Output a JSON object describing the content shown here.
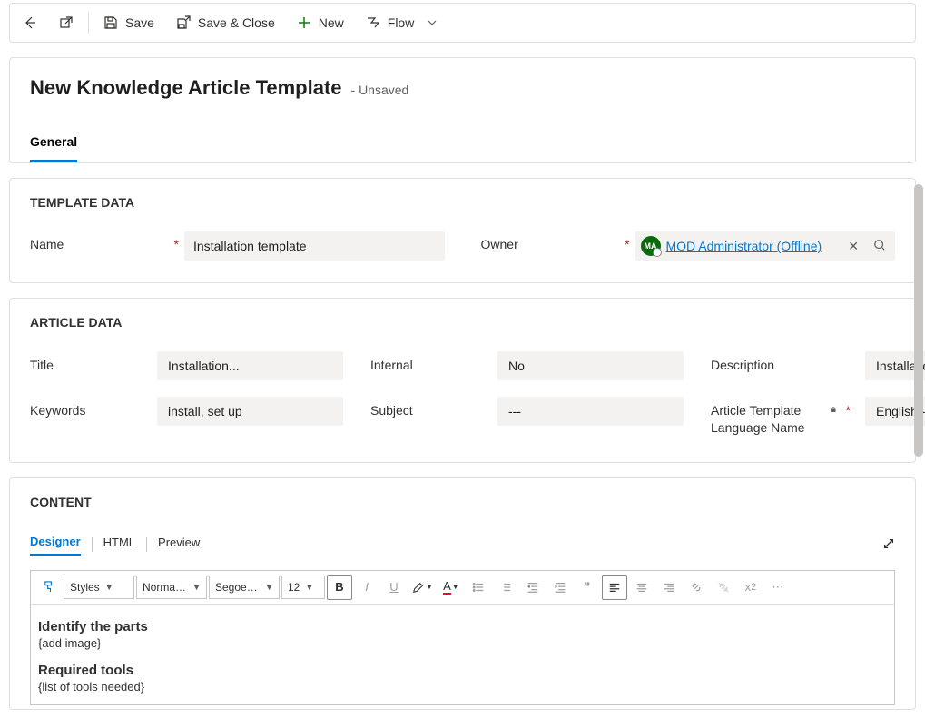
{
  "commands": {
    "save": "Save",
    "save_close": "Save & Close",
    "new": "New",
    "flow": "Flow"
  },
  "header": {
    "title": "New Knowledge Article Template",
    "status": "- Unsaved"
  },
  "form_tabs": [
    "General"
  ],
  "sections": {
    "template_data": {
      "title": "TEMPLATE DATA",
      "name_label": "Name",
      "name_value": "Installation template",
      "owner_label": "Owner",
      "owner_initials": "MA",
      "owner_value": "MOD Administrator (Offline)"
    },
    "article_data": {
      "title": "ARTICLE DATA",
      "title_label": "Title",
      "title_value": "Installation...",
      "internal_label": "Internal",
      "internal_value": "No",
      "description_label": "Description",
      "description_value": "Installation ins...",
      "keywords_label": "Keywords",
      "keywords_value": "install, set up",
      "subject_label": "Subject",
      "subject_value": "---",
      "lang_label": "Article Template Language Name",
      "lang_value": "English - Unite..."
    },
    "content": {
      "title": "CONTENT",
      "tabs": [
        "Designer",
        "HTML",
        "Preview"
      ],
      "toolbar": {
        "styles": "Styles",
        "format": "Normal (...",
        "font": "Segoe UI",
        "size": "12"
      },
      "body": {
        "h1": "Identify the parts",
        "p1": "{add image}",
        "h2": "Required tools",
        "p2": "{list of tools needed}"
      }
    }
  }
}
